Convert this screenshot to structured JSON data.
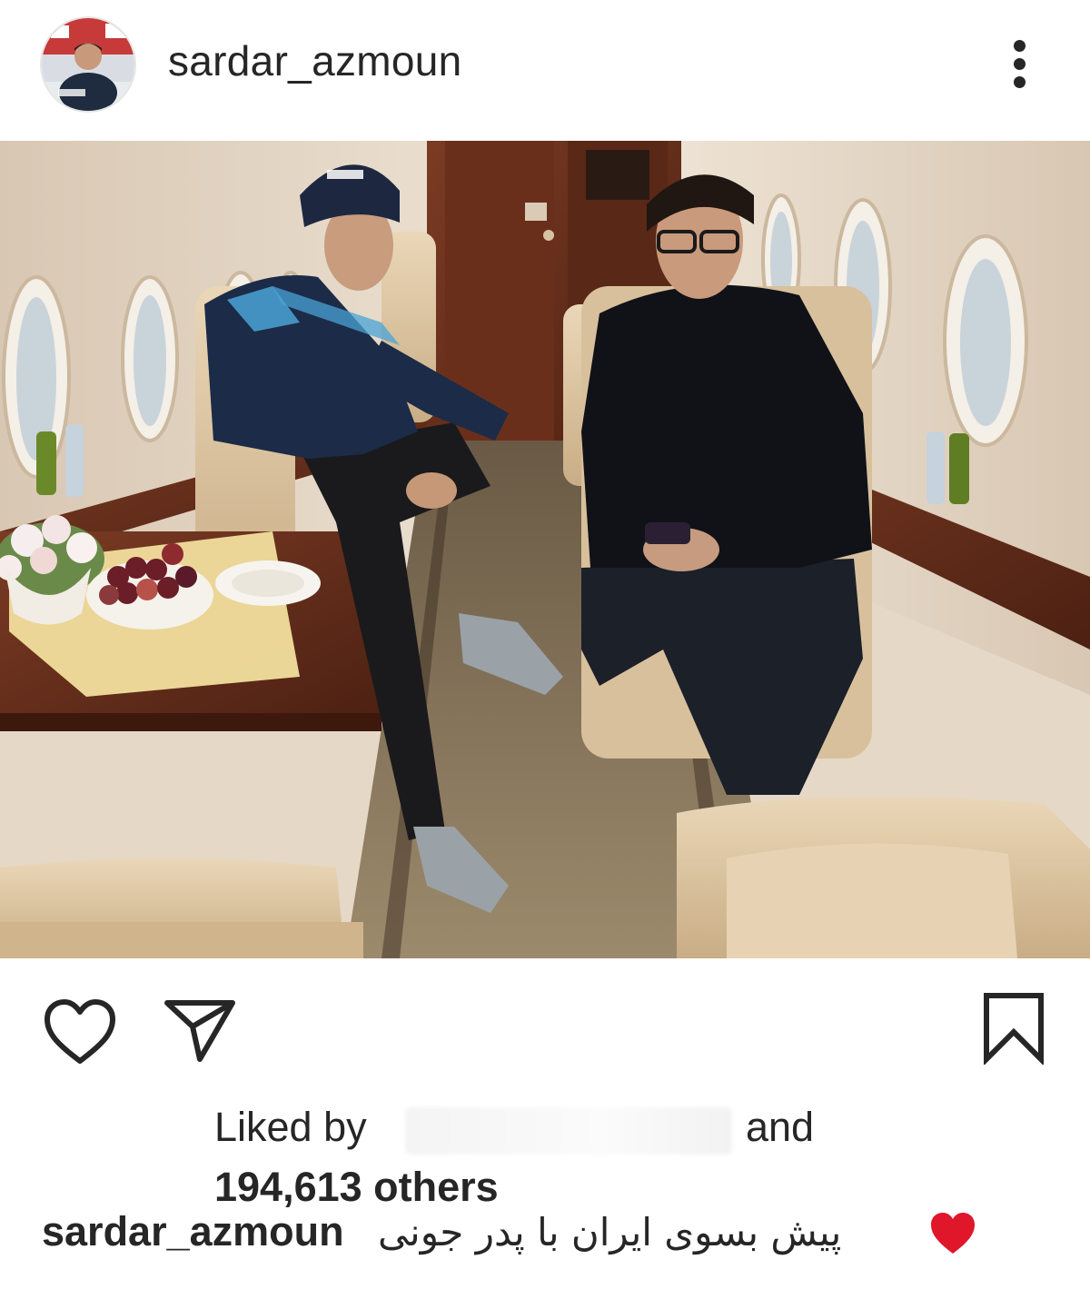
{
  "header": {
    "username": "sardar_azmoun",
    "avatar_icon": "profile-avatar",
    "more_icon": "more-vertical-icon"
  },
  "photo": {
    "icon": "post-photo"
  },
  "actions": {
    "like_icon": "heart-outline-icon",
    "share_icon": "paper-plane-icon",
    "save_icon": "bookmark-outline-icon"
  },
  "likes": {
    "liked_by_label": "Liked by",
    "and_label": "and",
    "others_count": "194,613 others"
  },
  "caption": {
    "username": "sardar_azmoun",
    "text": "پیش بسوی ایران با پدر جونی",
    "heart_color": "#e0162b"
  },
  "colors": {
    "text": "#262626",
    "background": "#ffffff"
  }
}
